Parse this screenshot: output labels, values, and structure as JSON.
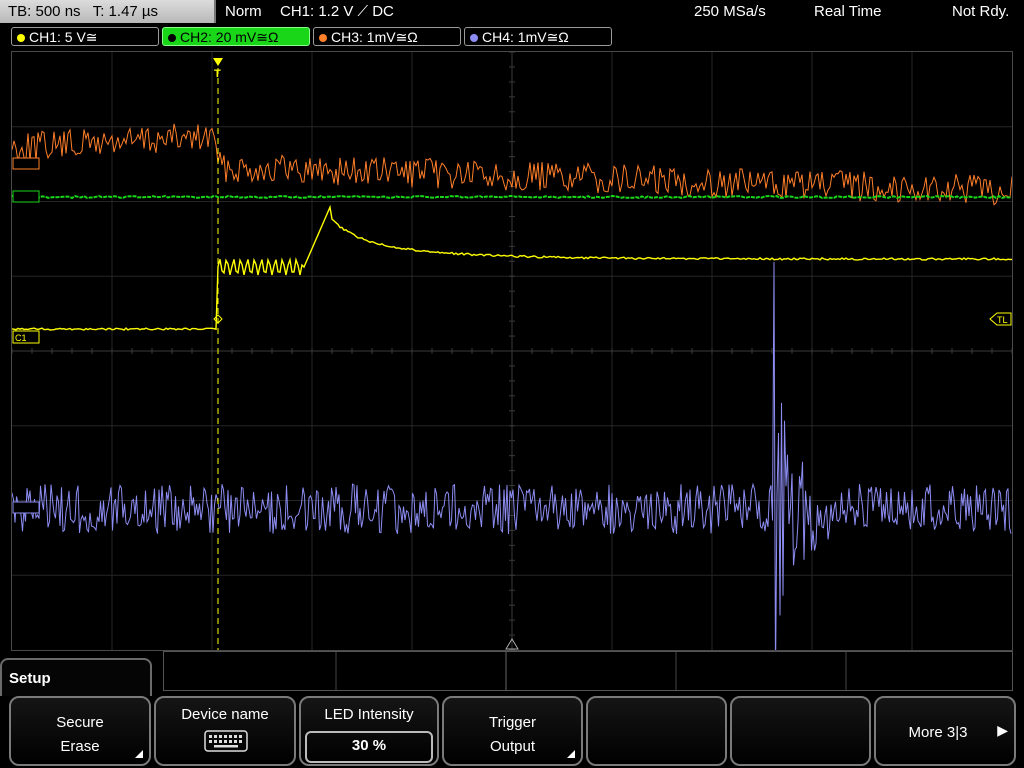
{
  "status": {
    "timebase": "TB: 500 ns",
    "time_offset": "T: 1.47 µs",
    "trigger_mode": "Norm",
    "trigger_info": "CH1: 1.2 V ⟋ DC",
    "sample_rate": "250 MSa/s",
    "acq_mode": "Real Time",
    "state": "Not Rdy."
  },
  "channels": [
    {
      "label": "CH1: 5 V≅",
      "color": "#ffff00",
      "active": false
    },
    {
      "label": "CH2: 20 mV≅Ω",
      "color": "#19d619",
      "active": true
    },
    {
      "label": "CH3: 1mV≅Ω",
      "color": "#ff7f2a",
      "active": false
    },
    {
      "label": "CH4: 1mV≅Ω",
      "color": "#8c8cf2",
      "active": false
    }
  ],
  "markers": {
    "ch1": "C1",
    "trigger_level": "TL",
    "trigger_pos": "T"
  },
  "menu": {
    "title": "Setup",
    "softkeys": [
      {
        "line1": "Secure",
        "line2": "Erase",
        "has_submenu": true
      },
      {
        "line1": "Device name",
        "icon": "keyboard-icon"
      },
      {
        "line1": "LED Intensity",
        "value": "30 %"
      },
      {
        "line1": "Trigger",
        "line2": "Output",
        "has_submenu": true
      },
      {
        "line1": ""
      },
      {
        "line1": ""
      },
      {
        "line1": "More 3|3",
        "arrow": "▶"
      }
    ]
  }
}
